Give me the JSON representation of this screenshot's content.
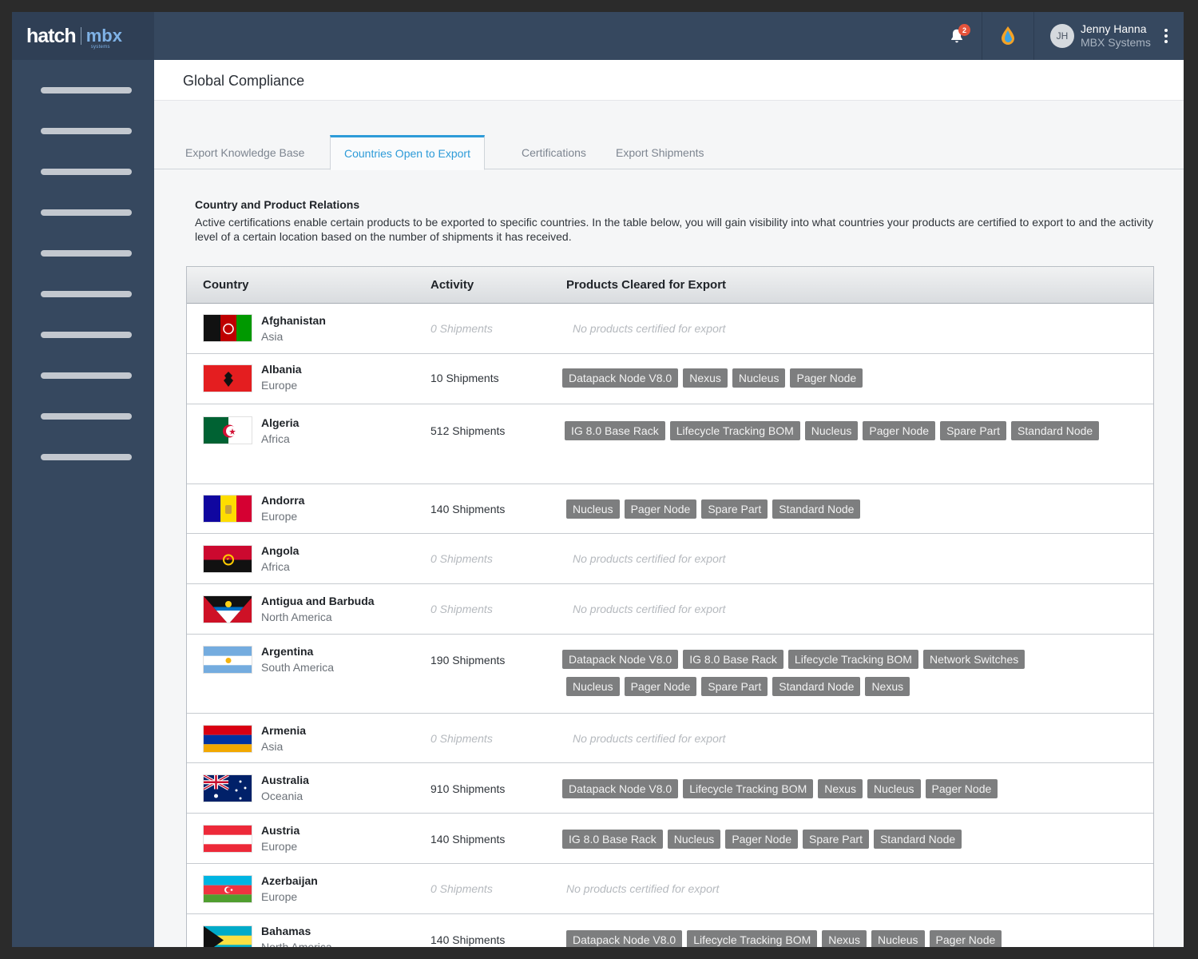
{
  "brand": {
    "left": "hatch",
    "right": "mbx",
    "sub": "systems"
  },
  "topbar": {
    "notification_count": "2",
    "user": {
      "initials": "JH",
      "name": "Jenny Hanna",
      "org": "MBX Systems"
    }
  },
  "page": {
    "title": "Global Compliance"
  },
  "tabs": [
    {
      "label": "Export Knowledge Base"
    },
    {
      "label": "Countries Open to Export",
      "active": true
    },
    {
      "label": "Certifications"
    },
    {
      "label": "Export Shipments"
    }
  ],
  "section": {
    "title": "Country and Product Relations",
    "description": "Active certifications enable certain products to be exported to specific countries. In the table below, you will gain visibility into what countries your products are certified to export to and the activity level of a certain location based on the number of shipments it has received."
  },
  "table": {
    "headers": {
      "country": "Country",
      "activity": "Activity",
      "products": "Products Cleared for Export"
    },
    "no_products_text": "No products certified for export",
    "rows": [
      {
        "country": "Afghanistan",
        "region": "Asia",
        "activity": "0 Shipments",
        "products": []
      },
      {
        "country": "Albania",
        "region": "Europe",
        "activity": "10 Shipments",
        "products": [
          "Datapack Node V8.0",
          "Nexus",
          "Nucleus",
          "Pager Node"
        ]
      },
      {
        "country": "Algeria",
        "region": "Africa",
        "activity": "512 Shipments",
        "products": [
          "IG 8.0 Base Rack",
          "Lifecycle Tracking BOM",
          "Nucleus",
          "Pager Node",
          "Spare Part",
          "Standard Node"
        ]
      },
      {
        "country": "Andorra",
        "region": "Europe",
        "activity": "140 Shipments",
        "products": [
          "Nucleus",
          "Pager Node",
          "Spare Part",
          "Standard Node"
        ]
      },
      {
        "country": "Angola",
        "region": "Africa",
        "activity": "0 Shipments",
        "products": []
      },
      {
        "country": "Antigua and Barbuda",
        "region": "North America",
        "activity": "0 Shipments",
        "products": []
      },
      {
        "country": "Argentina",
        "region": "South America",
        "activity": "190 Shipments",
        "products": [
          "Datapack Node V8.0",
          "IG 8.0 Base Rack",
          "Lifecycle Tracking BOM",
          "Network Switches",
          "Nucleus",
          "Pager Node",
          "Spare Part",
          "Standard Node",
          "Nexus"
        ]
      },
      {
        "country": "Armenia",
        "region": "Asia",
        "activity": "0 Shipments",
        "products": []
      },
      {
        "country": "Australia",
        "region": "Oceania",
        "activity": "910 Shipments",
        "products": [
          "Datapack Node V8.0",
          "Lifecycle Tracking BOM",
          "Nexus",
          "Nucleus",
          "Pager Node"
        ]
      },
      {
        "country": "Austria",
        "region": "Europe",
        "activity": "140 Shipments",
        "products": [
          "IG 8.0 Base Rack",
          "Nucleus",
          "Pager Node",
          "Spare Part",
          "Standard Node"
        ]
      },
      {
        "country": "Azerbaijan",
        "region": "Europe",
        "activity": "0 Shipments",
        "products": []
      },
      {
        "country": "Bahamas",
        "region": "North America",
        "activity": "140 Shipments",
        "products": [
          "Datapack Node V8.0",
          "Lifecycle Tracking BOM",
          "Nexus",
          "Nucleus",
          "Pager Node"
        ]
      }
    ]
  },
  "colors": {
    "accent": "#2d9bd8",
    "sidebar": "#36485f",
    "tag": "#7d7e7f",
    "badge": "#e5533b"
  }
}
